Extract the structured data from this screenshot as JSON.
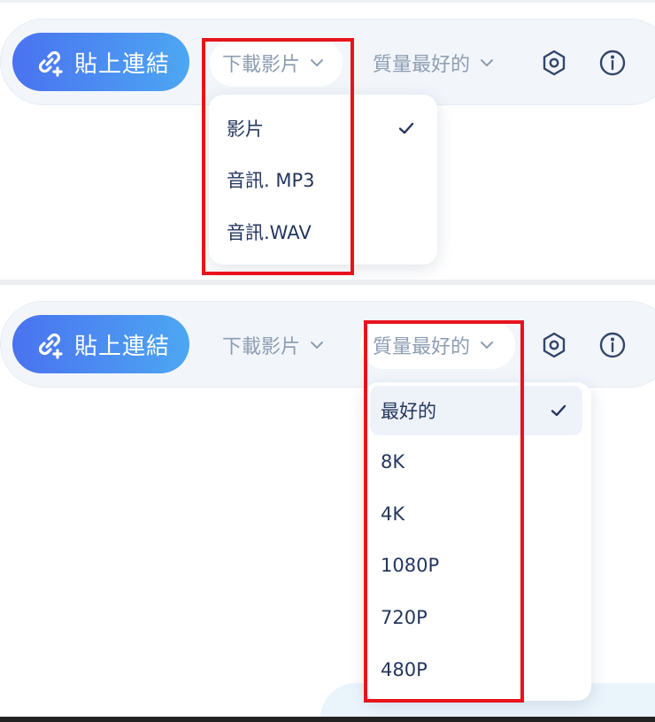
{
  "colors": {
    "accent_start": "#4a72f0",
    "accent_end": "#4da7f2",
    "toolbar_bg": "#f2f6fb",
    "menu_text": "#24365e",
    "muted_text": "#8d9db2",
    "highlight": "#e8131c"
  },
  "panel_a": {
    "toolbar": {
      "paste_label": "貼上連結",
      "format_label": "下載影片",
      "quality_label": "質量最好的",
      "settings_icon": "hexagon-settings-icon",
      "info_icon": "info-circle-icon"
    },
    "format_menu": {
      "items": [
        {
          "label": "影片",
          "selected": true
        },
        {
          "label": "音訊. MP3",
          "selected": false
        },
        {
          "label": "音訊.WAV",
          "selected": false
        }
      ]
    }
  },
  "panel_b": {
    "toolbar": {
      "paste_label": "貼上連結",
      "format_label": "下載影片",
      "quality_label": "質量最好的",
      "settings_icon": "hexagon-settings-icon",
      "info_icon": "info-circle-icon"
    },
    "quality_menu": {
      "items": [
        {
          "label": "最好的",
          "selected": true
        },
        {
          "label": "8K",
          "selected": false
        },
        {
          "label": "4K",
          "selected": false
        },
        {
          "label": "1080P",
          "selected": false
        },
        {
          "label": "720P",
          "selected": false
        },
        {
          "label": "480P",
          "selected": false
        }
      ]
    }
  }
}
